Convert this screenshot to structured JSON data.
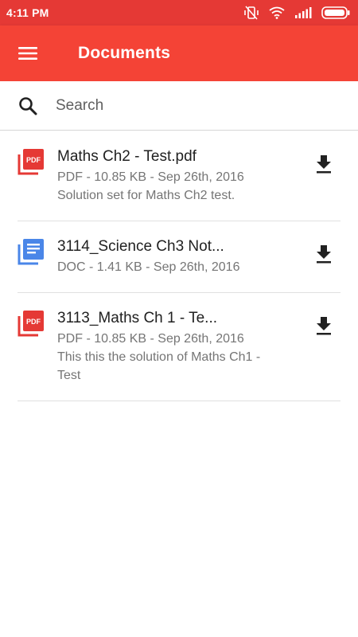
{
  "status_bar": {
    "time": "4:11 PM",
    "icons": [
      "vibrate-off-icon",
      "wifi-icon",
      "signal-icon",
      "battery-icon"
    ]
  },
  "app_bar": {
    "title": "Documents",
    "menu_icon": "hamburger-menu-icon",
    "color": "#f44336"
  },
  "search": {
    "placeholder": "Search",
    "value": ""
  },
  "documents": [
    {
      "title": "Maths Ch2 - Test.pdf",
      "meta": "PDF - 10.85 KB - Sep 26th, 2016",
      "description": "Solution set for Maths Ch2 test.",
      "type_icon": "pdf-icon"
    },
    {
      "title": "3114_Science Ch3 Not...",
      "meta": "DOC - 1.41 KB - Sep 26th, 2016",
      "description": "",
      "type_icon": "doc-icon"
    },
    {
      "title": "3113_Maths Ch 1 - Te...",
      "meta": "PDF - 10.85 KB - Sep 26th, 2016",
      "description": "This this the solution of Maths Ch1 - Test",
      "type_icon": "pdf-icon"
    }
  ],
  "colors": {
    "status_bar": "#e53935",
    "pdf_icon": "#e53935",
    "doc_icon": "#4a86e8",
    "secondary_text": "#757575"
  }
}
